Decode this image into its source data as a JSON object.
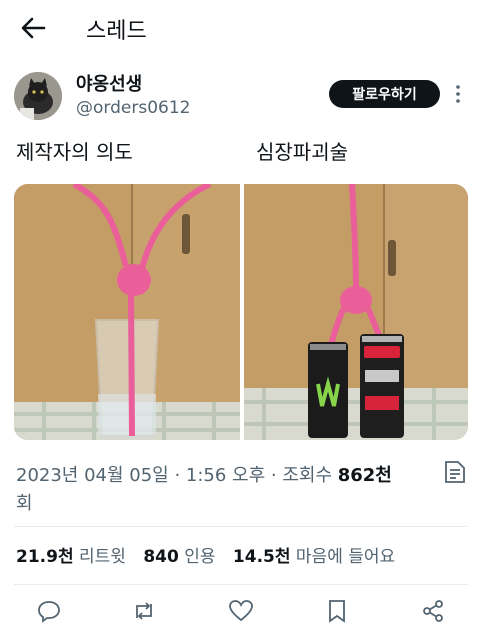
{
  "header": {
    "title": "스레드",
    "back_icon": "arrow-left-icon"
  },
  "author": {
    "display_name": "야옹선생",
    "handle": "@orders0612",
    "follow_label": "팔로우하기"
  },
  "tweet": {
    "text_left": "제작자의 의도",
    "text_right": "심장파괴술",
    "media": [
      {
        "description_icon": "photo-glass-straw"
      },
      {
        "description_icon": "photo-cans-straw"
      }
    ]
  },
  "meta": {
    "timestamp": "2023년 04월 05일 · 1:56 오후 · 조회수 ",
    "views": "862천",
    "views_suffix": "회"
  },
  "stats": {
    "retweets_count": "21.9천",
    "retweets_label": "리트윗",
    "quotes_count": "840",
    "quotes_label": "인용",
    "likes_count": "14.5천",
    "likes_label": "마음에 들어요"
  },
  "actions": [
    "reply-icon",
    "retweet-icon",
    "like-icon",
    "bookmark-icon",
    "share-icon"
  ],
  "colors": {
    "text": "#0f1419",
    "secondary": "#536471",
    "divider": "#e6ecf0",
    "straw": "#ea5f9a"
  }
}
